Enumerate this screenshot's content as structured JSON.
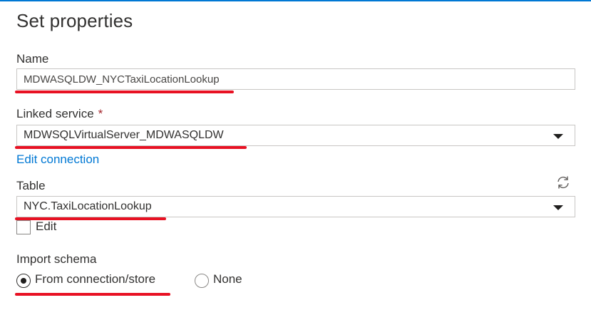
{
  "panel": {
    "title": "Set properties"
  },
  "name_field": {
    "label": "Name",
    "value": "MDWASQLDW_NYCTaxiLocationLookup"
  },
  "linked_service": {
    "label": "Linked service",
    "required_marker": "*",
    "value": "MDWSQLVirtualServer_MDWASQLDW",
    "edit_link": "Edit connection"
  },
  "table": {
    "label": "Table",
    "value": "NYC.TaxiLocationLookup",
    "edit_checkbox_label": "Edit",
    "edit_checked": false,
    "refresh_icon": "refresh-icon"
  },
  "import_schema": {
    "label": "Import schema",
    "options": [
      {
        "label": "From connection/store",
        "selected": true
      },
      {
        "label": "None",
        "selected": false
      }
    ]
  },
  "colors": {
    "accent": "#0078d4",
    "highlight_underline": "#e81123",
    "required": "#a4262c"
  }
}
